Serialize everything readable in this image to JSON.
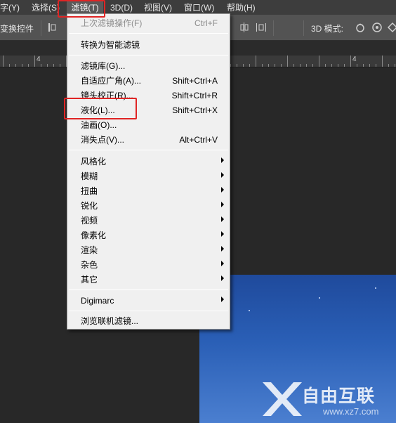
{
  "menubar": {
    "items": [
      "字(Y)",
      "选择(S)",
      "滤镜(T)",
      "3D(D)",
      "视图(V)",
      "窗口(W)",
      "帮助(H)"
    ]
  },
  "options_bar": {
    "transform_label": "变换控件",
    "mode_3d_label": "3D 模式:"
  },
  "ruler": {
    "numbers": [
      "4",
      "4"
    ]
  },
  "filter_menu": {
    "items": [
      {
        "label": "上次滤镜操作(F)",
        "shortcut": "Ctrl+F",
        "disabled": true
      },
      {
        "label": "转换为智能滤镜"
      },
      {
        "label": "滤镜库(G)..."
      },
      {
        "label": "自适应广角(A)...",
        "shortcut": "Shift+Ctrl+A"
      },
      {
        "label": "镜头校正(R)...",
        "shortcut": "Shift+Ctrl+R"
      },
      {
        "label": "液化(L)...",
        "shortcut": "Shift+Ctrl+X"
      },
      {
        "label": "油画(O)..."
      },
      {
        "label": "消失点(V)...",
        "shortcut": "Alt+Ctrl+V"
      },
      {
        "label": "风格化",
        "submenu": true
      },
      {
        "label": "模糊",
        "submenu": true
      },
      {
        "label": "扭曲",
        "submenu": true
      },
      {
        "label": "锐化",
        "submenu": true
      },
      {
        "label": "视频",
        "submenu": true
      },
      {
        "label": "像素化",
        "submenu": true
      },
      {
        "label": "渲染",
        "submenu": true
      },
      {
        "label": "杂色",
        "submenu": true
      },
      {
        "label": "其它",
        "submenu": true
      },
      {
        "label": "Digimarc",
        "submenu": true
      },
      {
        "label": "浏览联机滤镜..."
      }
    ]
  },
  "watermark": {
    "brand": "自由互联",
    "url": "www.xz7.com"
  },
  "colors": {
    "highlight": "#e02424",
    "menu_bg": "#f0f0f0",
    "sky": "#2a5fb6"
  }
}
